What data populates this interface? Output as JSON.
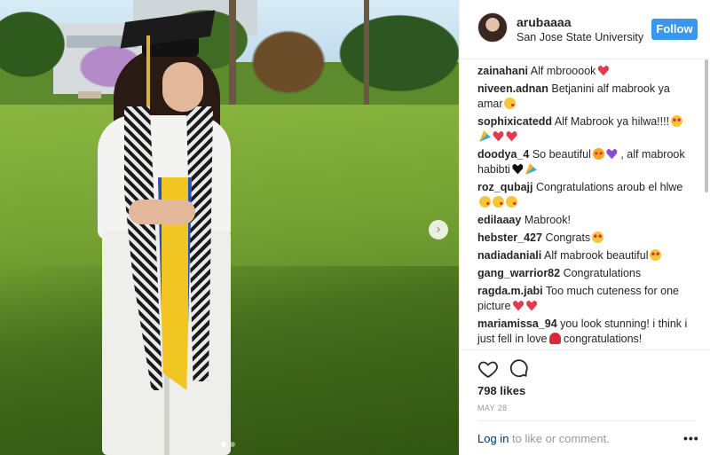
{
  "photo": {
    "alt": "Graduate in cap and gown posing on campus lawn",
    "next_icon": "chevron-right-icon",
    "next_glyph": "›",
    "carousel_total": 2,
    "carousel_active": 1
  },
  "header": {
    "username": "arubaaaa",
    "location": "San Jose State University",
    "follow_label": "Follow"
  },
  "comments": [
    {
      "user": "zainahani",
      "text": "Alf mbrooook",
      "emoji": [
        "heart-icon"
      ]
    },
    {
      "user": "niveen.adnan",
      "text": "Betjanini alf mabrook ya amar",
      "emoji": [
        "kiss-icon"
      ]
    },
    {
      "user": "sophixicatedd",
      "text": "Alf Mabrook ya hilwa!!!!",
      "emoji": [
        "heart-eyes-icon",
        "party-icon",
        "heart-icon",
        "heart-icon"
      ]
    },
    {
      "user": "doodya_4",
      "text": "So beautiful",
      "emoji": [
        "heart-eyes-cat-icon",
        "purple-heart-icon"
      ],
      "text2": ", alf mabrook habibti",
      "emoji2": [
        "black-heart-icon",
        "party-icon"
      ]
    },
    {
      "user": "roz_qubajj",
      "text": "Congratulations aroub el hlwe",
      "emoji": [
        "kiss-icon",
        "kiss-icon",
        "kiss-icon"
      ]
    },
    {
      "user": "edilaaay",
      "text": "Mabrook!",
      "emoji": []
    },
    {
      "user": "hebster_427",
      "text": "Congrats",
      "emoji": [
        "heart-eyes-icon"
      ]
    },
    {
      "user": "nadiadaniali",
      "text": "Alf mabrook beautiful",
      "emoji": [
        "heart-eyes-icon"
      ]
    },
    {
      "user": "gang_warrior82",
      "text": "Congratulations",
      "emoji": []
    },
    {
      "user": "ragda.m.jabi",
      "text": "Too much cuteness for one picture",
      "emoji": [
        "heart-icon",
        "heart-icon"
      ]
    },
    {
      "user": "mariamissa_94",
      "text": "you look stunning! i think i just fell in love",
      "emoji": [
        "rose-icon"
      ],
      "text2": "congratulations!",
      "emoji2": []
    }
  ],
  "actions": {
    "like_icon": "heart-outline-icon",
    "comment_icon": "comment-bubble-icon",
    "likes_text": "798 likes",
    "date": "MAY 28",
    "login_link": "Log in",
    "login_suffix": " to like or comment.",
    "more_label": "•••"
  },
  "colors": {
    "follow_button": "#3897f0",
    "link": "#003569",
    "muted": "#999999",
    "text": "#262626"
  }
}
